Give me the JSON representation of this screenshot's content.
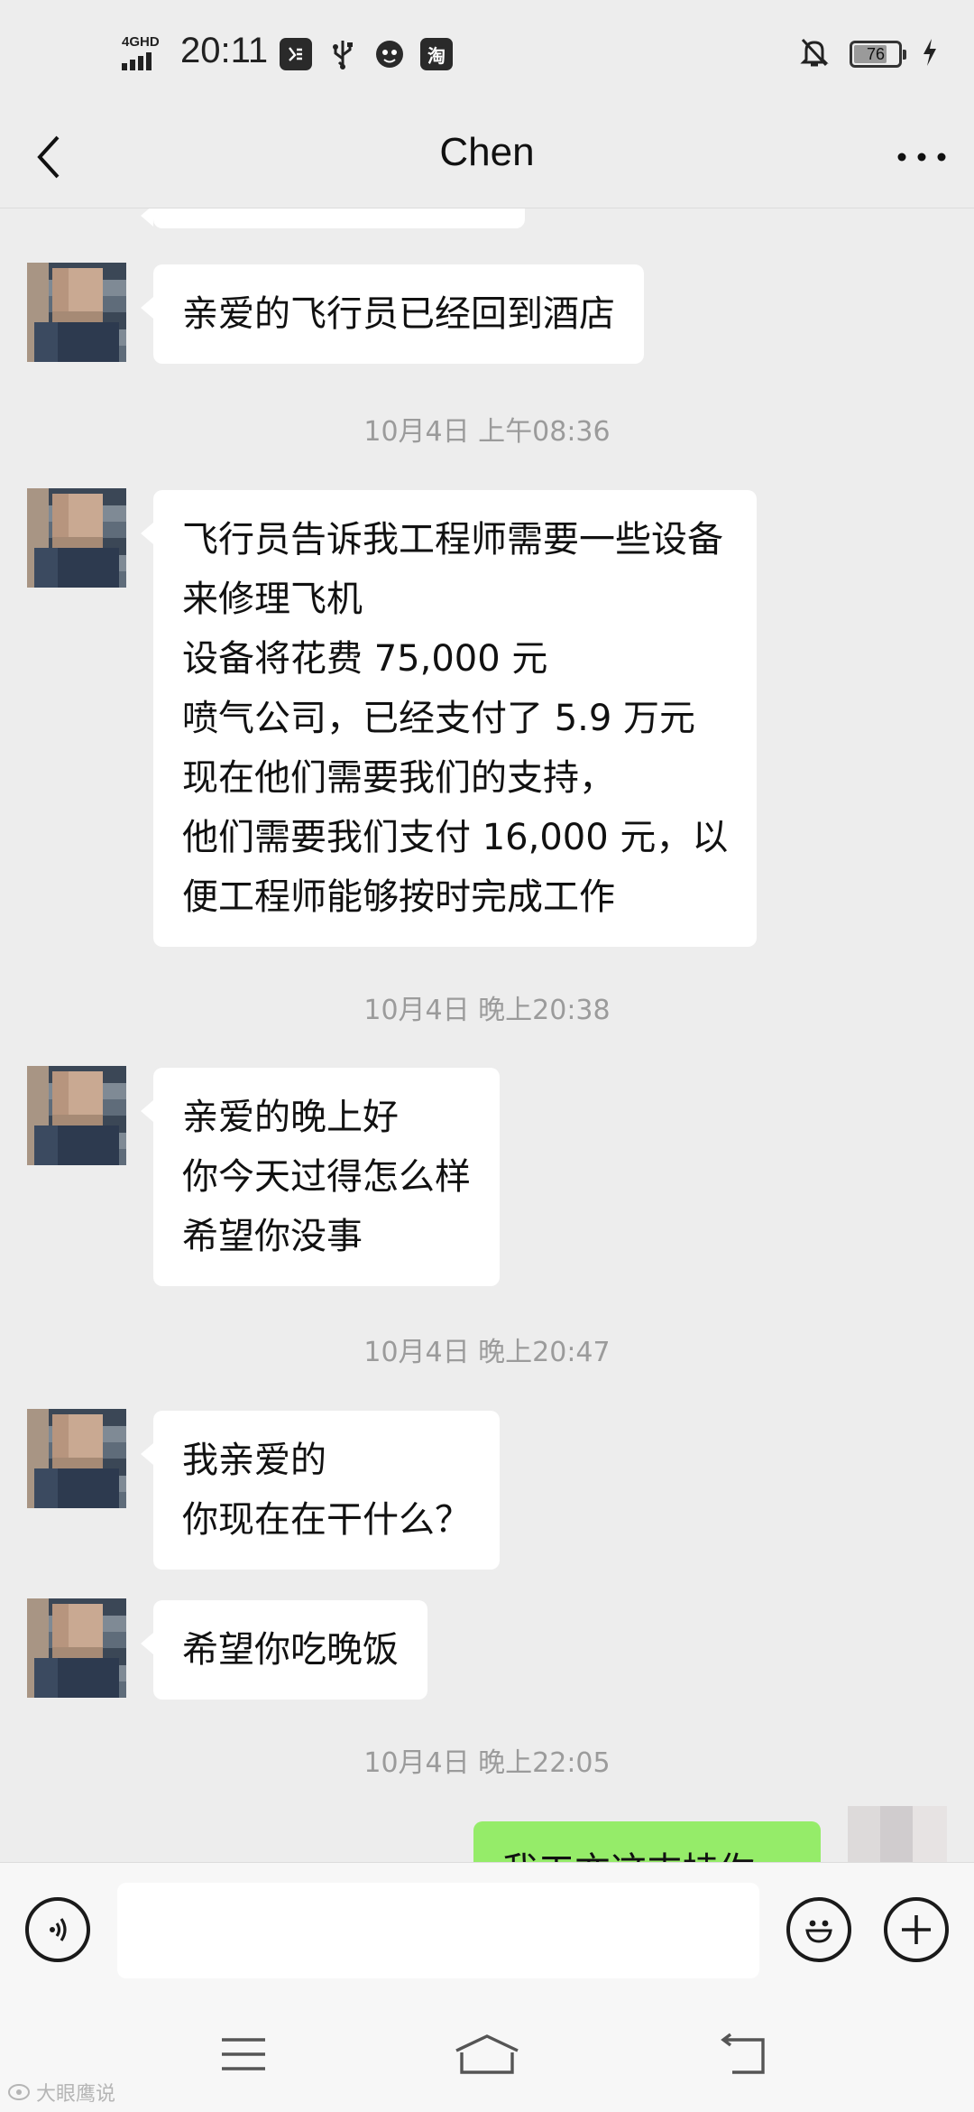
{
  "status_bar": {
    "network": "4GHD",
    "time": "20:11",
    "app_icon_label": "淘",
    "battery": "76",
    "battery_level": 0.76
  },
  "header": {
    "title": "Chen"
  },
  "chat": {
    "prev_msg_1": "亲爱的飞行员已经回到酒店",
    "time_1": "10月4日 上午08:36",
    "msg_2": {
      "lines": [
        "飞行员告诉我工程师需要一些设备",
        "来修理飞机",
        "设备将花费 75,000 元",
        "喷气公司，已经支付了 5.9 万元",
        "现在他们需要我们的支持，",
        "他们需要我们支付 16,000 元，以",
        "便工程师能够按时完成工作"
      ]
    },
    "time_2": "10月4日 晚上20:38",
    "msg_3": {
      "lines": [
        "亲爱的晚上好",
        "你今天过得怎么样",
        "希望你没事"
      ]
    },
    "time_3": "10月4日 晚上20:47",
    "msg_4": {
      "lines": [
        "我亲爱的",
        "你现在在干什么？"
      ]
    },
    "msg_5": "希望你吃晚饭",
    "time_4": "10月4日 晚上22:05",
    "outgoing_partial": "我工亦这支持你"
  },
  "input": {
    "value": "",
    "placeholder": ""
  },
  "watermark": "大眼鹰说",
  "colors": {
    "background": "#ededed",
    "incoming_bubble": "#ffffff",
    "outgoing_bubble": "#95ec69",
    "timestamp": "#9b9b9b"
  },
  "icons": {
    "back": "chevron-left-icon",
    "more": "more-dots-icon",
    "voice": "voice-icon",
    "emoji": "emoji-icon",
    "plus": "plus-icon",
    "nav_menu": "menu-icon",
    "nav_home": "home-icon",
    "nav_back": "back-arrow-icon"
  }
}
